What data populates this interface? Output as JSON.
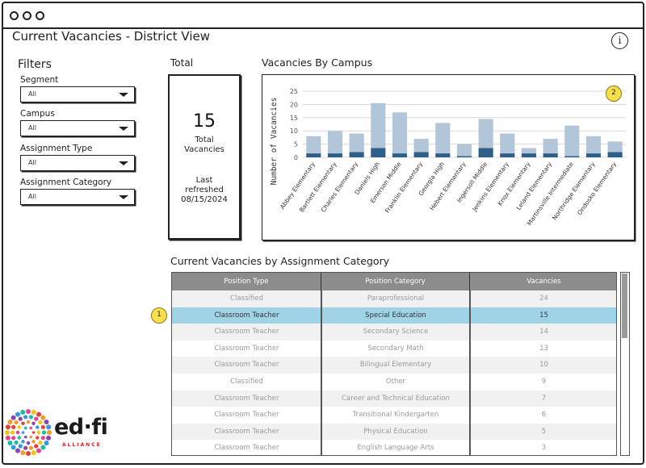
{
  "window": {
    "title": "Current Vacancies - District View"
  },
  "filters": {
    "heading": "Filters",
    "items": [
      {
        "label": "Segment",
        "value": "All"
      },
      {
        "label": "Campus",
        "value": "All"
      },
      {
        "label": "Assignment Type",
        "value": "All"
      },
      {
        "label": "Assignment Category",
        "value": "All"
      }
    ]
  },
  "total": {
    "heading": "Total",
    "number": "15",
    "label_line1": "Total",
    "label_line2": "Vacancies",
    "refresh_line1": "Last",
    "refresh_line2": "refreshed",
    "refresh_date": "08/15/2024"
  },
  "campus_chart": {
    "heading": "Vacancies By Campus",
    "badge": "2"
  },
  "chart_data": {
    "type": "bar",
    "stacked": true,
    "ylabel": "Number of Vacancies",
    "ylim": [
      0,
      25
    ],
    "yticks": [
      0,
      5,
      10,
      15,
      20,
      25
    ],
    "grid": true,
    "categories": [
      "Abbey Elementary",
      "Bartlett Elementary",
      "Charles Elementary",
      "Daniels High",
      "Emerson Middle",
      "Franklin Elementary",
      "Georgia High",
      "Hebert Elementary",
      "Ingersoll Middle",
      "Jenkins Elementary",
      "Knox Elementary",
      "Leland Elementary",
      "Martinsville Intermediate",
      "Northridge Elementary",
      "Ondosko Elementary"
    ],
    "series": [
      {
        "values": [
          1.5,
          1.5,
          2,
          3.5,
          1.5,
          2,
          1.5,
          0.5,
          3.5,
          1.5,
          1.5,
          1.5,
          0.5,
          1.5,
          2
        ],
        "color": "#2e5f8a"
      },
      {
        "values": [
          6.5,
          8.5,
          7,
          17,
          15.5,
          5,
          11.5,
          4.5,
          11,
          7.5,
          2,
          5.5,
          11.5,
          6.5,
          4
        ],
        "color": "#b3c6d9"
      }
    ]
  },
  "table": {
    "heading": "Current Vacancies by Assignment Category",
    "badge": "1",
    "columns": [
      "Position Type",
      "Position Category",
      "Vacancies"
    ],
    "rows": [
      [
        "Classified",
        "Paraprofessional",
        "24"
      ],
      [
        "Classroom Teacher",
        "Special Education",
        "15"
      ],
      [
        "Classroom Teacher",
        "Secondary Science",
        "14"
      ],
      [
        "Classroom Teacher",
        "Secondary Math",
        "13"
      ],
      [
        "Classroom Teacher",
        "Bilingual Elementary",
        "10"
      ],
      [
        "Classified",
        "Other",
        "9"
      ],
      [
        "Classroom Teacher",
        "Career and Technical Education",
        "7"
      ],
      [
        "Classroom Teacher",
        "Transitional Kindergarten",
        "6"
      ],
      [
        "Classroom Teacher",
        "Physical Education",
        "5"
      ],
      [
        "Classroom Teacher",
        "English Language Arts",
        "3"
      ]
    ],
    "selected_row": 1
  },
  "logo": {
    "text": "ed·fi",
    "sub": "ALLIANCE"
  },
  "colors": {
    "selected_row": "#9fd3e6",
    "badge": "#f7e04b",
    "bar_dark": "#2e5f8a",
    "bar_light": "#b3c6d9"
  }
}
